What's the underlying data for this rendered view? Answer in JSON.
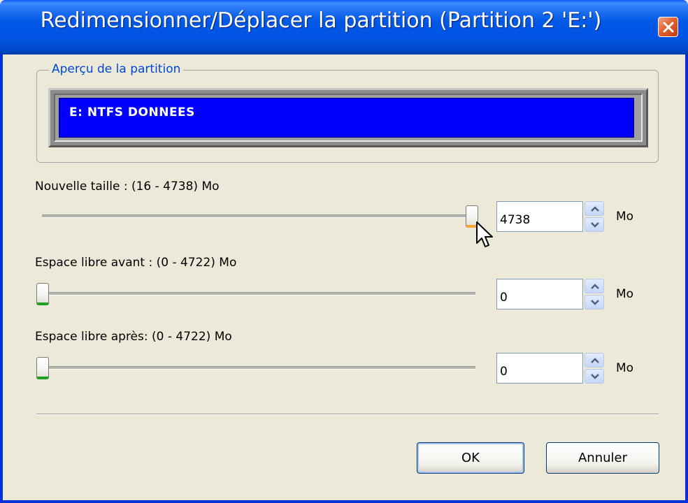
{
  "window": {
    "title": "Redimensionner/Déplacer la partition (Partition 2 'E:')"
  },
  "preview": {
    "group_label": "Aperçu de la partition",
    "partition_label": "E: NTFS DONNEES",
    "bar_color": "#0000fc"
  },
  "fields": [
    {
      "label": "Nouvelle taille : (16 - 4738) Mo",
      "value": "4738",
      "unit": "Mo",
      "min": 16,
      "max": 4738
    },
    {
      "label": "Espace libre avant : (0 - 4722) Mo",
      "value": "0",
      "unit": "Mo",
      "min": 0,
      "max": 4722
    },
    {
      "label": "Espace libre après: (0 - 4722) Mo",
      "value": "0",
      "unit": "Mo",
      "min": 0,
      "max": 4722
    }
  ],
  "buttons": {
    "ok_label": "OK",
    "cancel_label": "Annuler"
  },
  "icons": {
    "close": "close-x-icon",
    "spin_up": "chevron-up-icon",
    "spin_down": "chevron-down-icon",
    "cursor": "mouse-pointer-icon"
  },
  "colors": {
    "titlebar": "#0054e3",
    "legend_text": "#0046d5",
    "close_button": "#e3632f"
  }
}
